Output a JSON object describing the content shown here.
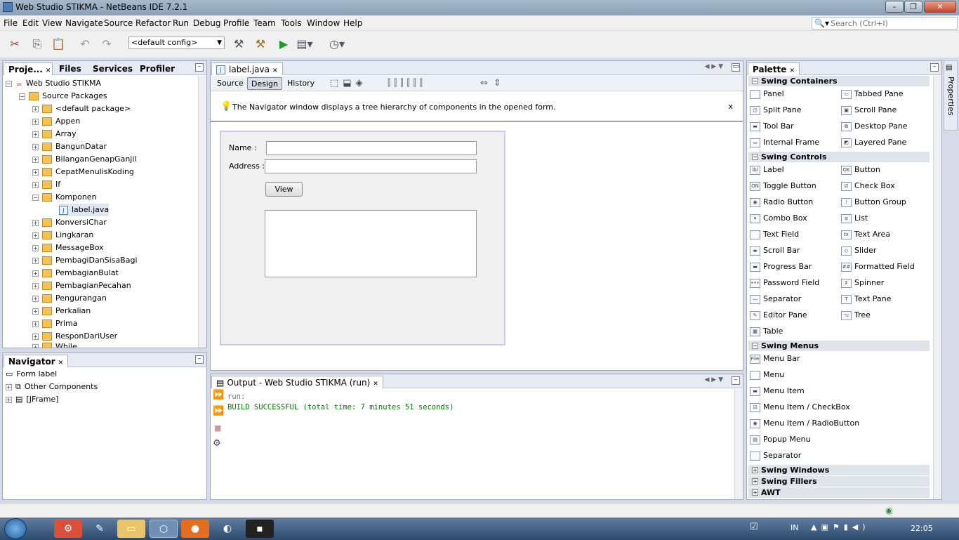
{
  "window": {
    "title": "Web Studio STIKMA - NetBeans IDE 7.2.1"
  },
  "menu": [
    "File",
    "Edit",
    "View",
    "Navigate",
    "Source",
    "Refactor",
    "Run",
    "Debug",
    "Profile",
    "Team",
    "Tools",
    "Window",
    "Help"
  ],
  "search": {
    "placeholder": "Search (Ctrl+I)"
  },
  "toolbar": {
    "config": "<default config>"
  },
  "projects": {
    "tabs": [
      "Proje...",
      "Files",
      "Services",
      "Profiler"
    ],
    "root": "Web Studio STIKMA",
    "source_packages": "Source Packages",
    "packages": [
      "<default package>",
      "Appen",
      "Array",
      "BangunDatar",
      "BilanganGenapGanjil",
      "CepatMenulisKoding",
      "If",
      "Komponen"
    ],
    "open_file": "label.java",
    "packages_after": [
      "KonversiChar",
      "Lingkaran",
      "MessageBox",
      "PembagiDanSisaBagi",
      "PembagianBulat",
      "PembagianPecahan",
      "Pengurangan",
      "Perkalian",
      "Prima",
      "ResponDariUser",
      "While"
    ]
  },
  "navigator": {
    "title": "Navigator",
    "items": [
      "Form label",
      "Other Components",
      "[JFrame]"
    ]
  },
  "editor": {
    "tab": "label.java",
    "modes": [
      "Source",
      "Design",
      "History"
    ],
    "hint": "The Navigator window displays a tree hierarchy of components in the opened form.",
    "hint_close": "x",
    "form": {
      "name_label": "Name :",
      "address_label": "Address :",
      "view_button": "View"
    }
  },
  "output": {
    "title": "Output - Web Studio STIKMA (run)",
    "lines": [
      "run:",
      "BUILD SUCCESSFUL (total time: 7 minutes 51 seconds)"
    ],
    "success_color": "#008000"
  },
  "palette": {
    "title": "Palette",
    "side_tab": "Properties",
    "containers": {
      "title": "Swing Containers",
      "items": [
        "Panel",
        "Tabbed Pane",
        "Split Pane",
        "Scroll Pane",
        "Tool Bar",
        "Desktop Pane",
        "Internal Frame",
        "Layered Pane"
      ]
    },
    "controls": {
      "title": "Swing Controls",
      "items": [
        "Label",
        "Button",
        "Toggle Button",
        "Check Box",
        "Radio Button",
        "Button Group",
        "Combo Box",
        "List",
        "Text Field",
        "Text Area",
        "Scroll Bar",
        "Slider",
        "Progress Bar",
        "Formatted Field",
        "Password Field",
        "Spinner",
        "Separator",
        "Text Pane",
        "Editor Pane",
        "Tree",
        "Table"
      ]
    },
    "menus": {
      "title": "Swing Menus",
      "items": [
        "Menu Bar",
        "Menu",
        "Menu Item",
        "Menu Item / CheckBox",
        "Menu Item / RadioButton",
        "Popup Menu",
        "Separator"
      ]
    },
    "collapsed": [
      "Swing Windows",
      "Swing Fillers",
      "AWT"
    ]
  },
  "taskbar": {
    "lang": "IN",
    "time": "22:05"
  }
}
